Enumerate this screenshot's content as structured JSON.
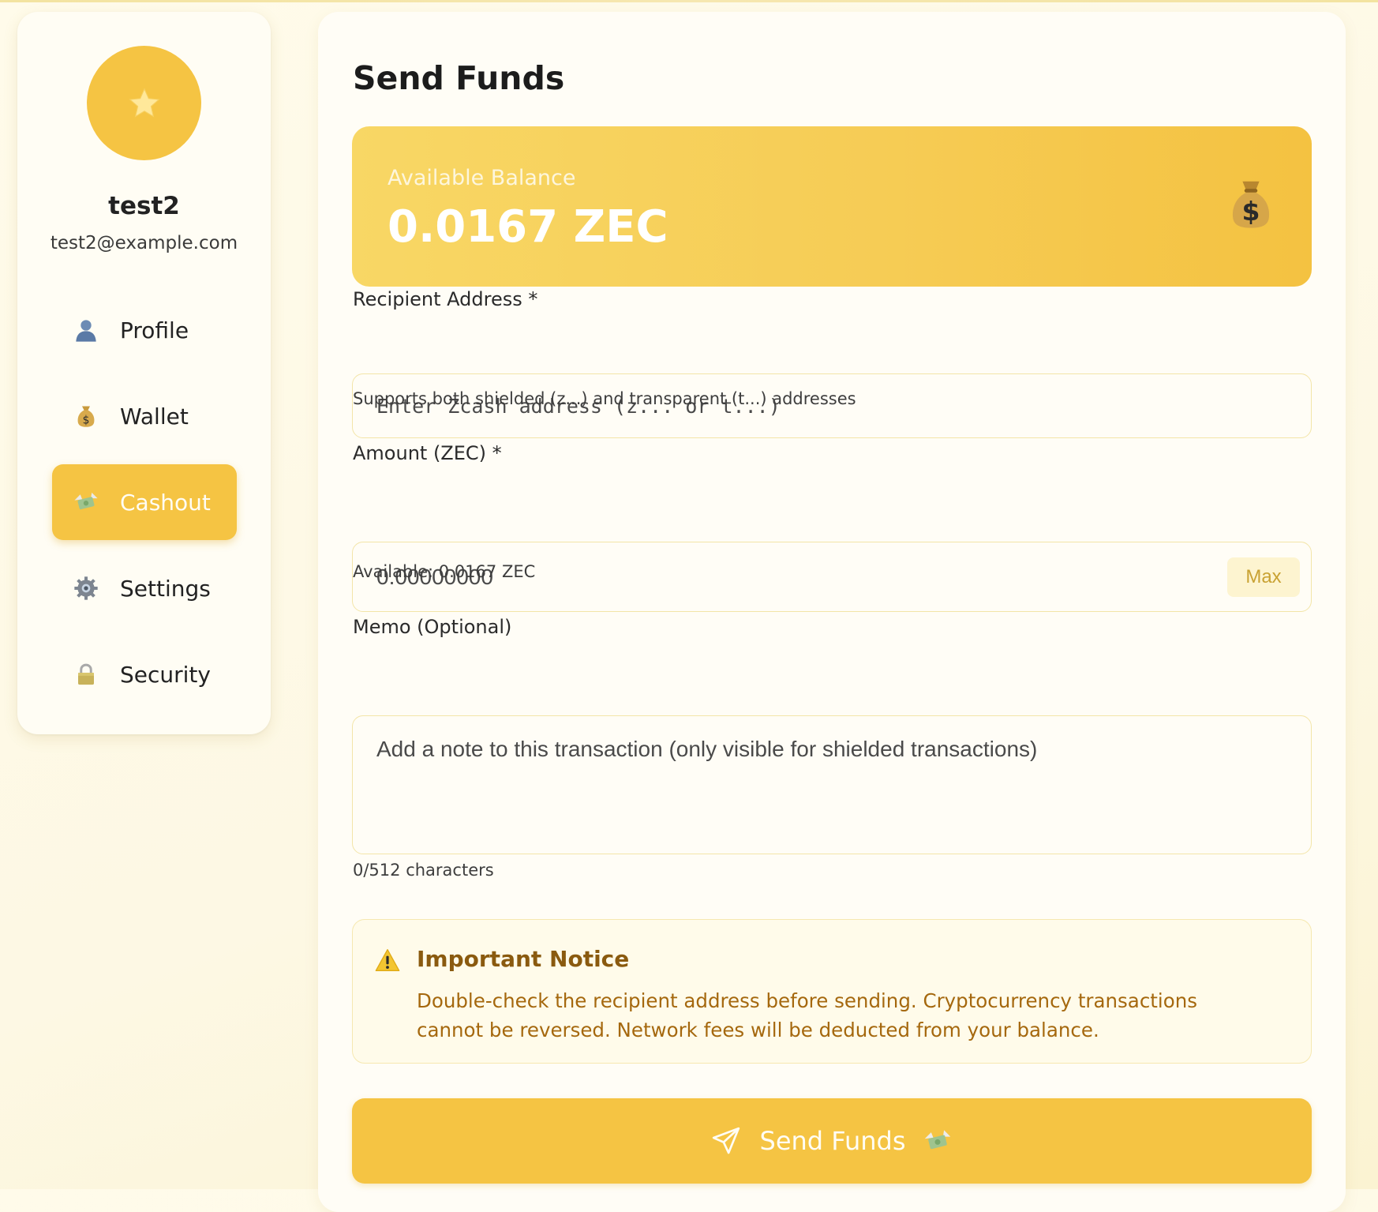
{
  "user": {
    "name": "test2",
    "email": "test2@example.com"
  },
  "sidebar": {
    "items": [
      {
        "label": "Profile",
        "icon": "user-icon"
      },
      {
        "label": "Wallet",
        "icon": "money-bag-icon"
      },
      {
        "label": "Cashout",
        "icon": "money-wings-icon",
        "active": true
      },
      {
        "label": "Settings",
        "icon": "gear-icon"
      },
      {
        "label": "Security",
        "icon": "lock-icon"
      }
    ]
  },
  "main": {
    "title": "Send Funds",
    "balance": {
      "label": "Available Balance",
      "value": "0.0167 ZEC"
    },
    "recipient": {
      "label": "Recipient Address *",
      "placeholder": "Enter Zcash address (z... or t...)",
      "hint": "Supports both shielded (z...) and transparent (t...) addresses"
    },
    "amount": {
      "label": "Amount (ZEC) *",
      "placeholder": "0.00000000",
      "max_label": "Max",
      "hint": "Available: 0.0167 ZEC"
    },
    "memo": {
      "label": "Memo (Optional)",
      "placeholder": "Add a note to this transaction (only visible for shielded transactions)",
      "counter": "0/512 characters"
    },
    "notice": {
      "title": "Important Notice",
      "text": "Double-check the recipient address before sending. Cryptocurrency transactions cannot be reversed. Network fees will be deducted from your balance."
    },
    "submit_label": "Send Funds"
  },
  "colors": {
    "accent": "#f5c443",
    "background": "#fffbea",
    "notice_text": "#a5680e"
  }
}
